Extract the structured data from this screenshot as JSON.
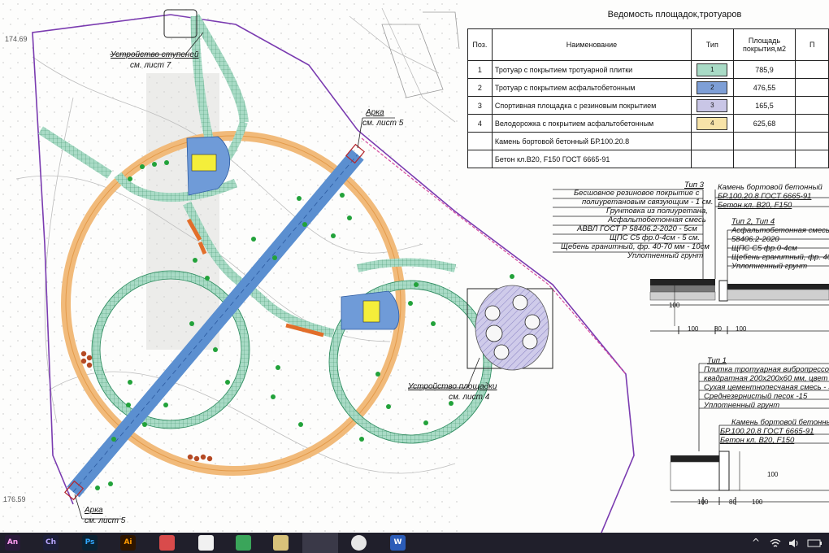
{
  "colors": {
    "sidewalk": "#a9dbc6",
    "asphalt": "#5b8fd0",
    "rubber": "#c9c6e6",
    "bike_path": "#f3c88a",
    "taskbar": "#201f2b"
  },
  "plan_labels": {
    "stairs": "Устройство ступеней",
    "stairs_sheet": "см. лист 7",
    "arch_top": "Арка",
    "arch_top_sheet": "см. лист 5",
    "arch_bottom": "Арка",
    "arch_bottom_sheet": "см. лист 5",
    "playground": "Устройство площадки",
    "playground_sheet": "см. лист 4",
    "elev_left": "174.69",
    "elev_left2": "176.59"
  },
  "schedule": {
    "title": "Ведомость площадок,тротуаров",
    "headers": {
      "pos": "Поз.",
      "name": "Наименование",
      "type": "Тип",
      "area": "Площадь покрытия,м2",
      "extra": "П"
    },
    "rows": [
      {
        "pos": "1",
        "name": "Тротуар с покрытием тротуарной плитки",
        "type": "1",
        "area": "785,9"
      },
      {
        "pos": "2",
        "name": "Тротуар с покрытием асфальтобетонным",
        "type": "2",
        "area": "476,55"
      },
      {
        "pos": "3",
        "name": "Спортивная площадка с резиновым покрытием",
        "type": "3",
        "area": "165,5"
      },
      {
        "pos": "4",
        "name": "Велодорожка с покрытием асфальтобетонным",
        "type": "4",
        "area": "625,68"
      },
      {
        "pos": "",
        "name": "Камень бортовой бетонный БР.100.20.8",
        "type": "",
        "area": ""
      },
      {
        "pos": "",
        "name": "Бетон кл.В20, F150 ГОСТ 6665-91",
        "type": "",
        "area": ""
      }
    ]
  },
  "sections": {
    "type3_title": "Тип 3",
    "type3_lines": [
      "Бесшовное резиновое покрытие с",
      "полиуретановым связующим - 1 см.",
      "Грунтовка из полиуретана,",
      "Асфальтобетонная смесь",
      "АВВЛ ГОСТ Р 58406.2-2020    - 5см",
      "ЩПС С5 фр.0-4см   - 5 см.",
      "Щебень гранитный, фр. 40-70 мм   - 10см",
      "Уплотненный грунт"
    ],
    "curb_title": "Камень бортовой бетонный",
    "curb_lines": [
      "БР.100.20.8 ГОСТ 6665-91",
      "Бетон кл. В20, F150"
    ],
    "type24_title": "Тип 2, Тип 4",
    "type24_lines": [
      "Асфальтобетонная смесь А",
      "58406.2-2020",
      "ЩПС С5 фр.0-4см",
      "Щебень гранитный, фр. 40-",
      "Уплотненный грунт"
    ],
    "dims_a": [
      "100",
      "80",
      "100"
    ],
    "dim_v_a": "100",
    "type1_title": "Тип 1",
    "type1_lines": [
      "Плитка тротуарная вибропрессов",
      "квадратная 200х200х60 мм, цвет с",
      "Сухая цементнопесчаная смесь - 3",
      "Среднезернистый песок          -15",
      "Уплотненный грунт"
    ],
    "curb2_title": "Камень бортовой бетонный",
    "curb2_lines": [
      "БР.100.20.8 ГОСТ 6665-91",
      "Бетон кл. В20, F150"
    ],
    "dims_b": [
      "100",
      "80",
      "100"
    ],
    "dim_v_b": "100"
  },
  "taskbar": {
    "apps": [
      {
        "label": "An",
        "icon": "animate-icon",
        "color": "#2a1a3a",
        "fg": "#ff9cf0"
      },
      {
        "label": "Ch",
        "icon": "character-animator-icon",
        "color": "#1d1f3a",
        "fg": "#b9a6ff"
      },
      {
        "label": "Ps",
        "icon": "photoshop-icon",
        "color": "#0b2233",
        "fg": "#31a8ff"
      },
      {
        "label": "Ai",
        "icon": "illustrator-icon",
        "color": "#2e1500",
        "fg": "#ff9a00"
      },
      {
        "label": "",
        "icon": "pdf-viewer-icon",
        "color": "#d94b4b",
        "fg": "#ffffff"
      },
      {
        "label": "",
        "icon": "file-icon",
        "color": "#f1f1f1",
        "fg": "#333333"
      },
      {
        "label": "",
        "icon": "spreadsheet-icon",
        "color": "#3aa55a",
        "fg": "#ffffff"
      },
      {
        "label": "",
        "icon": "paint-icon",
        "color": "#d8c27a",
        "fg": "#333333"
      },
      {
        "label": "",
        "icon": "telegram-icon",
        "color": "#2aa3df",
        "fg": "#ffffff"
      },
      {
        "label": "",
        "icon": "chrome-icon",
        "color": "#e6e6e6",
        "fg": "#333333"
      },
      {
        "label": "W",
        "icon": "word-icon",
        "color": "#2b5cb8",
        "fg": "#ffffff"
      }
    ],
    "tray": {
      "chevron": "^",
      "wifi": "wifi-icon",
      "volume": "volume-icon",
      "battery": "battery-icon"
    }
  }
}
